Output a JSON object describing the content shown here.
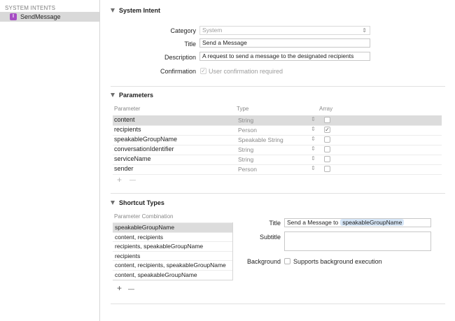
{
  "sidebar": {
    "header": "SYSTEM INTENTS",
    "items": [
      {
        "badge": "I",
        "label": "SendMessage"
      }
    ]
  },
  "system_intent": {
    "section_title": "System Intent",
    "category_label": "Category",
    "category_value": "System",
    "title_label": "Title",
    "title_value": "Send a Message",
    "description_label": "Description",
    "description_value": "A request to send a message to the designated recipients",
    "confirmation_label": "Confirmation",
    "confirmation_text": "User confirmation required",
    "confirmation_checked": true
  },
  "parameters": {
    "section_title": "Parameters",
    "columns": [
      "Parameter",
      "Type",
      "Array"
    ],
    "rows": [
      {
        "name": "content",
        "type": "String",
        "array": false
      },
      {
        "name": "recipients",
        "type": "Person",
        "array": true
      },
      {
        "name": "speakableGroupName",
        "type": "Speakable String",
        "array": false
      },
      {
        "name": "conversationIdentifier",
        "type": "String",
        "array": false
      },
      {
        "name": "serviceName",
        "type": "String",
        "array": false
      },
      {
        "name": "sender",
        "type": "Person",
        "array": false
      }
    ],
    "add_label": "+",
    "remove_label": "—"
  },
  "shortcut_types": {
    "section_title": "Shortcut Types",
    "list_header": "Parameter Combination",
    "combinations": [
      "speakableGroupName",
      "content, recipients",
      "recipients, speakableGroupName",
      "recipients",
      "content, recipients, speakableGroupName",
      "content, speakableGroupName"
    ],
    "add_label": "+",
    "remove_label": "—",
    "title_label": "Title",
    "title_prefix": "Send a Message to",
    "title_token": "speakableGroupName",
    "subtitle_label": "Subtitle",
    "subtitle_value": "",
    "background_label": "Background",
    "background_text": "Supports background execution",
    "background_checked": false
  },
  "colors": {
    "intent_badge": "#a64dc4",
    "selection": "#dcdcdc",
    "token_bg": "#d6e6f7"
  }
}
